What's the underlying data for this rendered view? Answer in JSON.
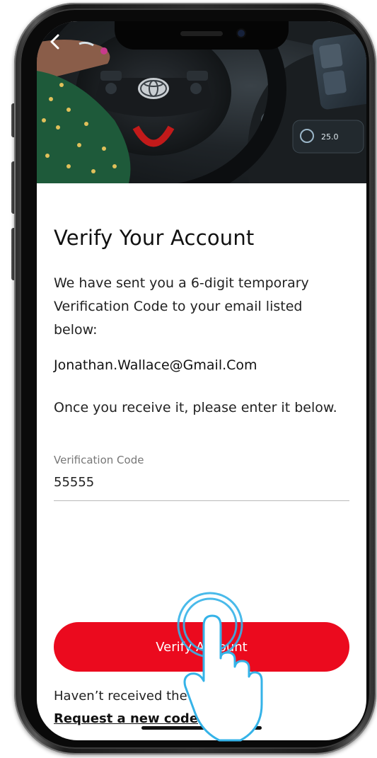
{
  "screen": {
    "title": "Verify Your Account",
    "intro": "We have sent you a 6-digit temporary Verification Code to your email listed below:",
    "email": "Jonathan.Wallace@Gmail.Com",
    "instruction": "Once you receive it, please enter it below.",
    "verification_field": {
      "label": "Verification Code",
      "value": "55555"
    },
    "verify_button_label": "Verify Account",
    "resend_prompt": "Haven’t received the code?",
    "resend_link": "Request a new code"
  },
  "icons": {
    "back": "chevron-left-icon",
    "hero_logo": "toyota-logo",
    "tap_gesture": "tap-hand-icon"
  },
  "colors": {
    "accent": "#eb0a1e",
    "text": "#111111",
    "muted": "#777777"
  }
}
